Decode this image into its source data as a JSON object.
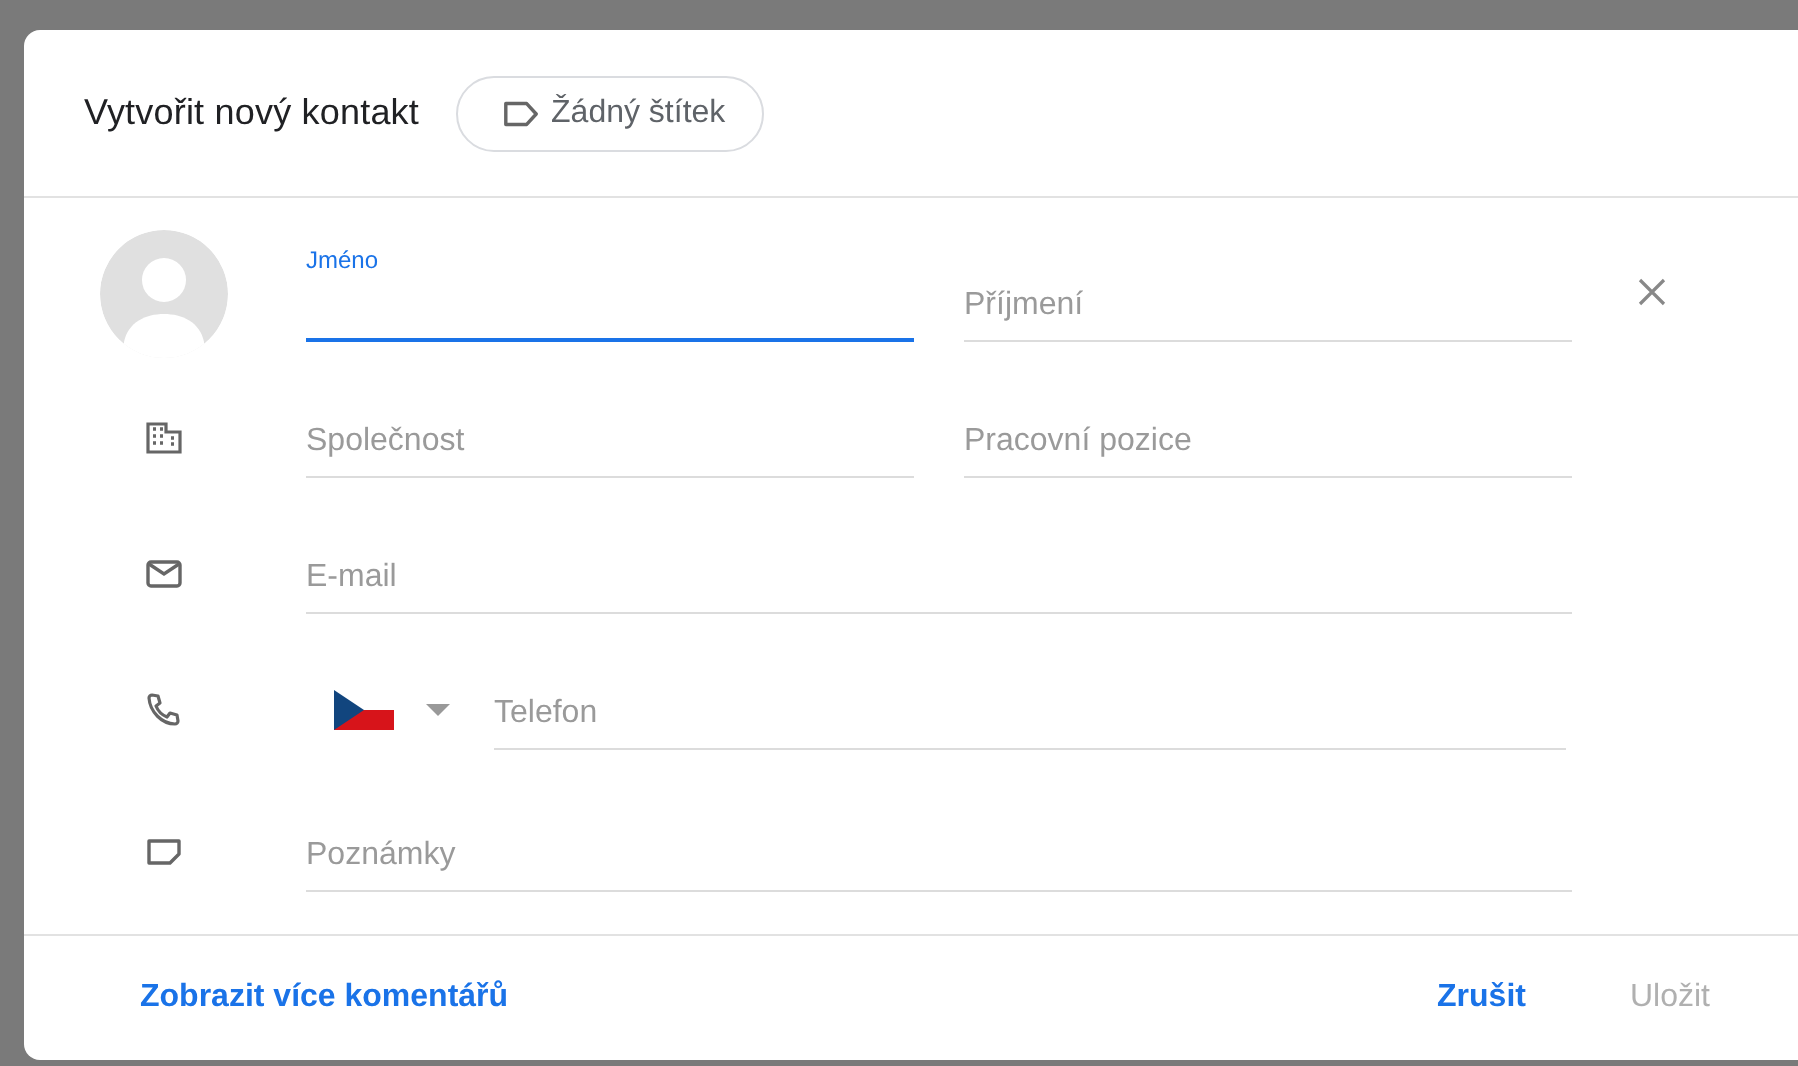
{
  "dialog": {
    "title": "Vytvořit nový kontakt",
    "label_chip": "Žádný štítek"
  },
  "rows": [
    {
      "kind": "name",
      "fields": [
        {
          "placeholder": "Jméno",
          "focused": true
        },
        {
          "placeholder": "Příjmení",
          "focused": false
        }
      ]
    },
    {
      "kind": "company",
      "fields": [
        {
          "placeholder": "Společnost",
          "focused": false
        },
        {
          "placeholder": "Pracovní pozice",
          "focused": false
        }
      ]
    },
    {
      "kind": "email",
      "fields": [
        {
          "placeholder": "E-mail",
          "focused": false
        }
      ]
    },
    {
      "kind": "phone",
      "fields": [
        {
          "placeholder": "Telefon",
          "focused": false
        }
      ]
    },
    {
      "kind": "notes",
      "fields": [
        {
          "placeholder": "Poznámky",
          "focused": false
        }
      ]
    }
  ],
  "footer": {
    "link": "Zobrazit více komentářů",
    "buttons": [
      {
        "label": "Zrušit",
        "disabled": false
      },
      {
        "label": "Uložit",
        "disabled": true
      }
    ]
  }
}
